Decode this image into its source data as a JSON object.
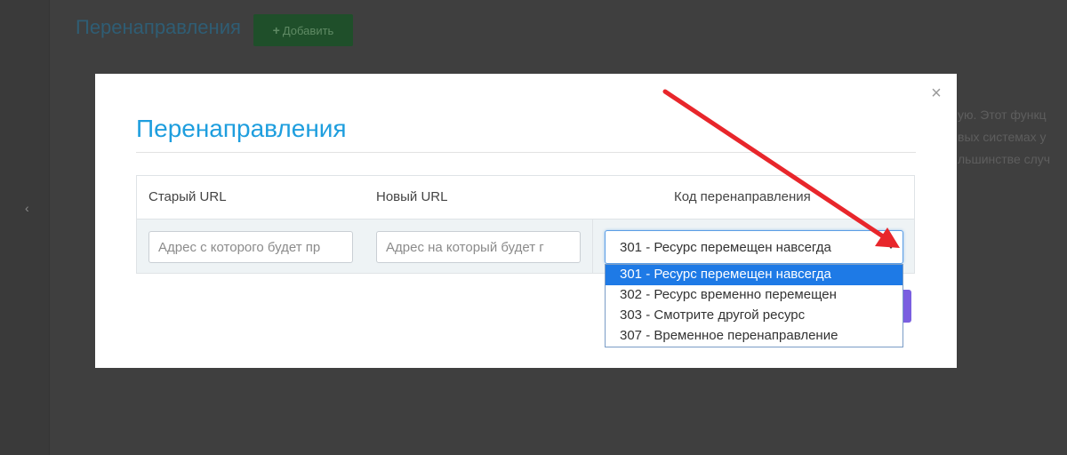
{
  "background": {
    "page_title": "Перенаправления",
    "add_button_label": "Добавить",
    "add_button_icon": "+",
    "sidebar_toggle_glyph": "‹",
    "description_lines": [
      "ую. Этот функц",
      "вых системах у",
      "льшинстве случ"
    ]
  },
  "modal": {
    "close_glyph": "×",
    "title": "Перенаправления",
    "table": {
      "headers": [
        "Старый URL",
        "Новый URL",
        "Код перенаправления"
      ],
      "old_url": {
        "value": "",
        "placeholder": "Адрес с которого будет пр"
      },
      "new_url": {
        "value": "",
        "placeholder": "Адрес на который будет г"
      },
      "redirect_code": {
        "selected": "301 - Ресурс перемещен навсегда",
        "options": [
          "301 - Ресурс перемещен навсегда",
          "302 - Ресурс временно перемещен",
          "303 - Смотрите другой ресурс",
          "307 - Временное перенаправление"
        ]
      }
    }
  },
  "colors": {
    "accent_title": "#1e9ede",
    "selected_option": "#1e7ae6",
    "annotation_arrow": "#e8262b",
    "submit_button": "#7a5fe0"
  },
  "icons": {
    "close": "close-icon",
    "add": "plus-icon",
    "dropdown": "chevron-down-icon",
    "sidebar": "chevron-left-icon"
  }
}
